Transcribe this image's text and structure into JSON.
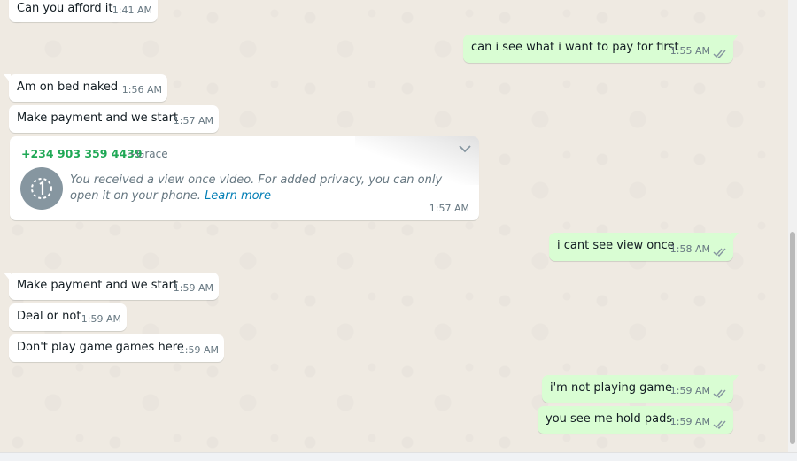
{
  "colors": {
    "chat_background": "#efeae2",
    "incoming_bubble": "#ffffff",
    "outgoing_bubble": "#d9fdd3",
    "sender_phone": "#1fa855",
    "link": "#027eb5",
    "read_ticks": "#53bdeb"
  },
  "messages": {
    "m1": {
      "text": "Can you afford it",
      "time": "1:41 AM"
    },
    "m2": {
      "text": "can i see what i want to pay for first",
      "time": "1:55 AM"
    },
    "m3": {
      "text": "Am on bed  naked",
      "time": "1:56 AM"
    },
    "m4": {
      "text": "Make payment and we start",
      "time": "1:57 AM"
    },
    "m5": {
      "sender_phone": "+234 903 359 4439",
      "sender_name": "~Grace",
      "text": "You received a view once video. For added privacy, you can only open it on your phone.",
      "link": "Learn more",
      "time": "1:57 AM"
    },
    "m6": {
      "text": "i cant see view once",
      "time": "1:58 AM"
    },
    "m7": {
      "text": "Make payment and we start",
      "time": "1:59 AM"
    },
    "m8": {
      "text": "Deal or not",
      "time": "1:59 AM"
    },
    "m9": {
      "text": "Don't play game games here",
      "time": "1:59 AM"
    },
    "m10": {
      "text": "i'm not playing game",
      "time": "1:59 AM"
    },
    "m11": {
      "text": "you see me hold pads",
      "time": "1:59 AM"
    }
  },
  "icons": {
    "view_once": "view-once-icon",
    "read_ticks": "double-check-icon",
    "menu": "chevron-down-icon"
  }
}
